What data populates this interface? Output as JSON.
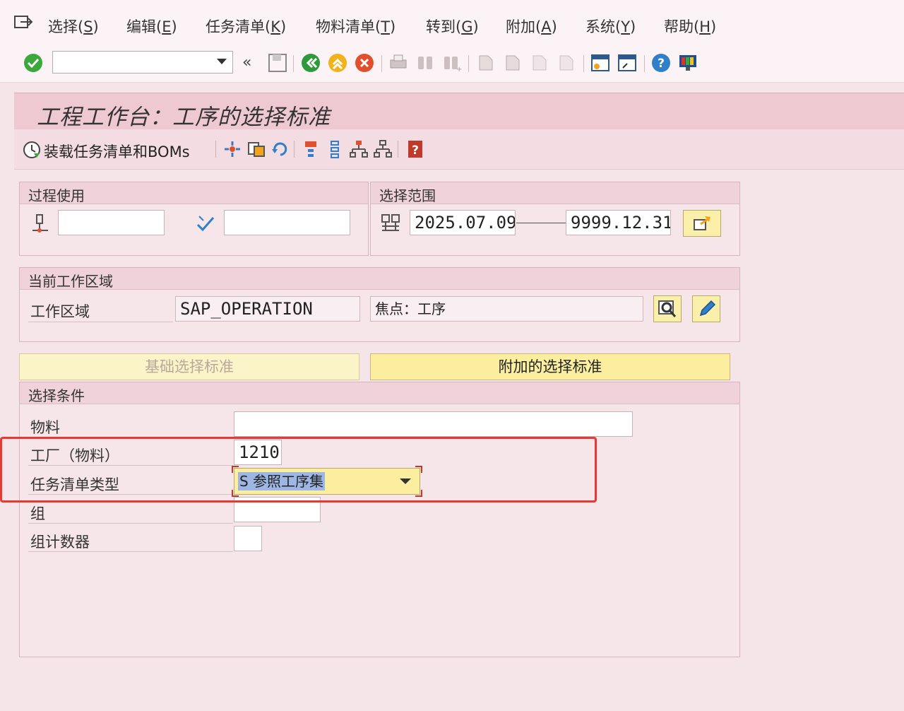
{
  "menu": [
    {
      "label": "选择",
      "key": "(S)",
      "hotkey": "S"
    },
    {
      "label": "编辑",
      "key": "(E)",
      "hotkey": "E"
    },
    {
      "label": "任务清单",
      "key": "(K)",
      "hotkey": "K"
    },
    {
      "label": "物料清单",
      "key": "(T)",
      "hotkey": "T"
    },
    {
      "label": "转到",
      "key": "(G)",
      "hotkey": "G"
    },
    {
      "label": "附加",
      "key": "(A)",
      "hotkey": "A"
    },
    {
      "label": "系统",
      "key": "(Y)",
      "hotkey": "Y"
    },
    {
      "label": "帮助",
      "key": "(H)",
      "hotkey": "H"
    }
  ],
  "toolbar": {
    "command_value": "",
    "history_glyph": "«"
  },
  "title": "工程工作台：工序的选择标准",
  "app_toolbar": {
    "load_label": "装载任务清单和BOMs"
  },
  "process_use": {
    "title": "过程使用",
    "field1": "",
    "field2": ""
  },
  "selection_range": {
    "title": "选择范围",
    "from": "2025.07.09",
    "to": "9999.12.31"
  },
  "work_area": {
    "title": "当前工作区域",
    "label": "工作区域",
    "value": "SAP_OPERATION",
    "focus": "焦点：工序"
  },
  "tabs": {
    "basic": "基础选择标准",
    "additional": "附加的选择标准"
  },
  "criteria": {
    "title": "选择条件",
    "rows": [
      {
        "label": "物料",
        "value": ""
      },
      {
        "label": "工厂（物料）",
        "value": "1210"
      },
      {
        "label": "任务清单类型",
        "value": "S 参照工序集"
      },
      {
        "label": "组",
        "value": ""
      },
      {
        "label": "组计数器",
        "value": ""
      }
    ]
  },
  "colors": {
    "highlight": "#e53935",
    "title_bg": "#eec9d2",
    "button_yellow": "#fbf2b4",
    "selected_text_bg": "#6c8fd0"
  }
}
